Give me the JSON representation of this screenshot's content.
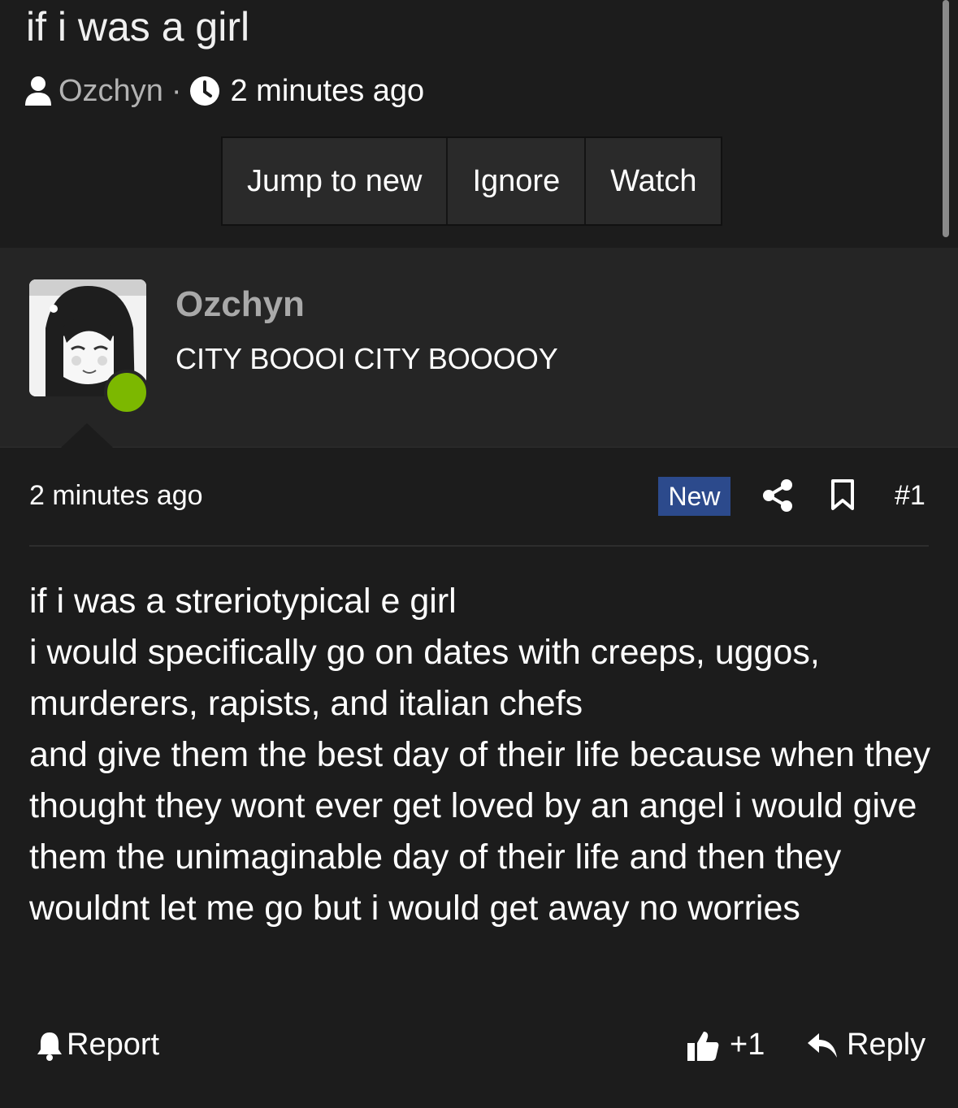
{
  "thread": {
    "title": "if i was a girl",
    "author": "Ozchyn",
    "separator": "·",
    "time": "2 minutes ago"
  },
  "actions": {
    "jump_to_new": "Jump to new",
    "ignore": "Ignore",
    "watch": "Watch"
  },
  "post": {
    "username": "Ozchyn",
    "user_title": "CITY BOOOI CITY BOOOOY",
    "online": true,
    "time": "2 minutes ago",
    "badge": "New",
    "number": "#1",
    "body": [
      "if i was a streriotypical e girl",
      "i would specifically go on dates with creeps, uggos, murderers, rapists, and italian chefs",
      "and give them the best day of their life because when they thought they wont ever get loved by an angel i would give them the unimaginable day of their life and then they wouldnt let me go but i would get away no worries"
    ],
    "report_label": "Report",
    "like_count": "+1",
    "reply_label": "Reply"
  },
  "icons": {
    "author": "user-icon",
    "time": "clock-icon",
    "share": "share-icon",
    "bookmark": "bookmark-icon",
    "report": "bell-icon",
    "like": "thumbs-up-icon",
    "reply": "reply-icon"
  },
  "colors": {
    "background": "#1c1c1c",
    "user_panel": "#252525",
    "new_badge": "#2c4a8c",
    "online": "#7cb800",
    "muted_text": "#b3b3b3"
  }
}
